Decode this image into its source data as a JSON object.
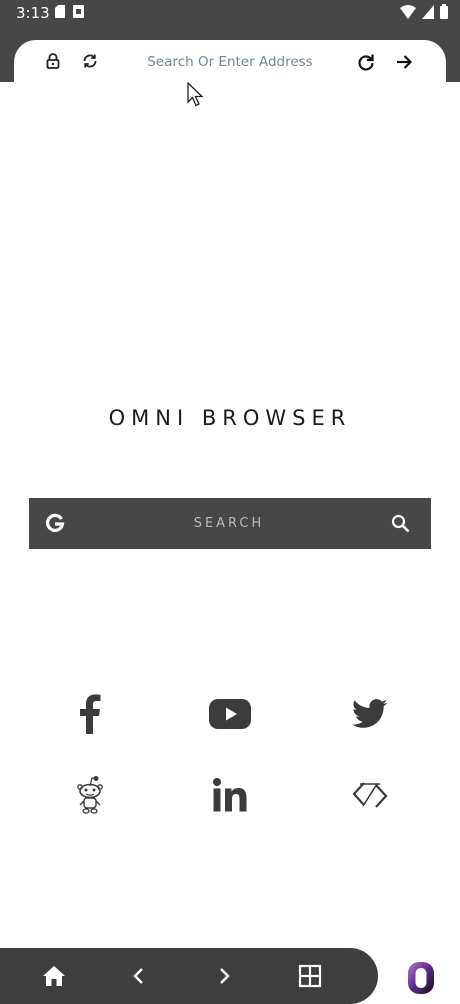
{
  "status_bar": {
    "time": "3:13",
    "icons": [
      "sim-card-icon",
      "notification-icon",
      "wifi-icon",
      "signal-icon",
      "battery-icon"
    ]
  },
  "address_bar": {
    "placeholder": "Search Or Enter Address",
    "icons": [
      "lock-icon",
      "sync-icon",
      "reload-icon",
      "go-arrow-icon"
    ]
  },
  "brand": {
    "title": "OMNI BROWSER"
  },
  "search": {
    "label": "SEARCH",
    "engine_icon": "google-g-icon",
    "action_icon": "search-icon"
  },
  "shortcuts": [
    {
      "name": "facebook",
      "icon": "facebook-icon"
    },
    {
      "name": "youtube",
      "icon": "youtube-icon"
    },
    {
      "name": "twitter",
      "icon": "twitter-icon"
    },
    {
      "name": "reddit",
      "icon": "reddit-icon"
    },
    {
      "name": "linkedin",
      "icon": "linkedin-icon"
    },
    {
      "name": "web",
      "icon": "web-app-icon"
    }
  ],
  "bottom_nav": {
    "items": [
      "home-icon",
      "back-icon",
      "forward-icon",
      "tabs-grid-icon"
    ],
    "menu_icon": "omni-logo-icon"
  },
  "colors": {
    "dark_gray": "#474747",
    "nav_gray": "#3e3e3e",
    "placeholder_text": "#6f8796",
    "brand_text": "#1b1b1b",
    "logo_purple": "#5b2a86"
  }
}
